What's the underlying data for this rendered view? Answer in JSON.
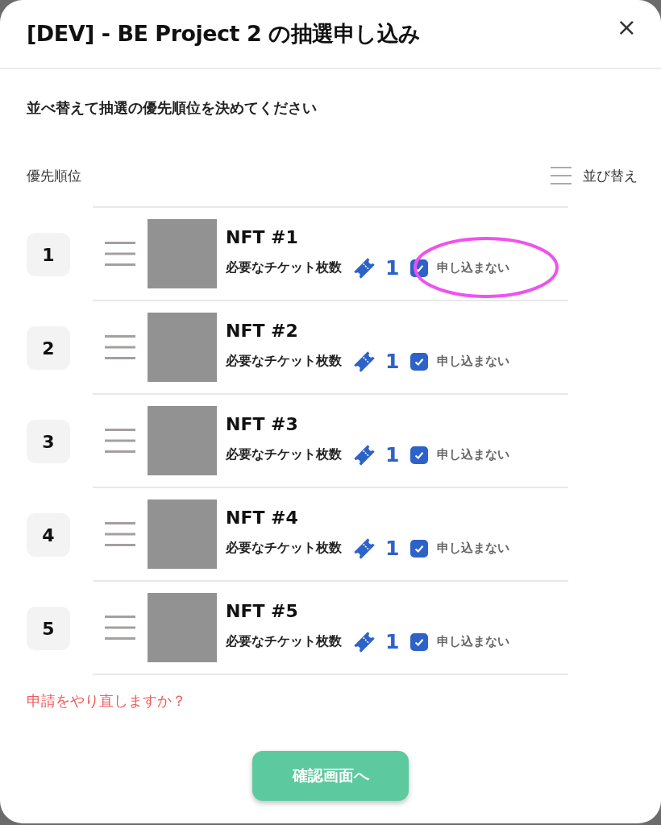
{
  "dialog": {
    "title": "[DEV] - BE Project 2 の抽選申し込み",
    "close": "×"
  },
  "instruction": "並べ替えて抽選の優先順位を決めてください",
  "priority_label": "優先順位",
  "sort_button": "並び替え",
  "items": [
    {
      "rank": "1",
      "name": "NFT #1",
      "ticket_label": "必要なチケット枚数",
      "tickets": "1",
      "opt_out": {
        "label": "申し込まない",
        "checked": true
      },
      "highlighted": true
    },
    {
      "rank": "2",
      "name": "NFT #2",
      "ticket_label": "必要なチケット枚数",
      "tickets": "1",
      "opt_out": {
        "label": "申し込まない",
        "checked": true
      },
      "highlighted": false
    },
    {
      "rank": "3",
      "name": "NFT #3",
      "ticket_label": "必要なチケット枚数",
      "tickets": "1",
      "opt_out": {
        "label": "申し込まない",
        "checked": true
      },
      "highlighted": false
    },
    {
      "rank": "4",
      "name": "NFT #4",
      "ticket_label": "必要なチケット枚数",
      "tickets": "1",
      "opt_out": {
        "label": "申し込まない",
        "checked": true
      },
      "highlighted": false
    },
    {
      "rank": "5",
      "name": "NFT #5",
      "ticket_label": "必要なチケット枚数",
      "tickets": "1",
      "opt_out": {
        "label": "申し込まない",
        "checked": true
      },
      "highlighted": false
    }
  ],
  "reapply_link": "申請をやり直しますか？",
  "confirm_button": "確認画面へ"
}
